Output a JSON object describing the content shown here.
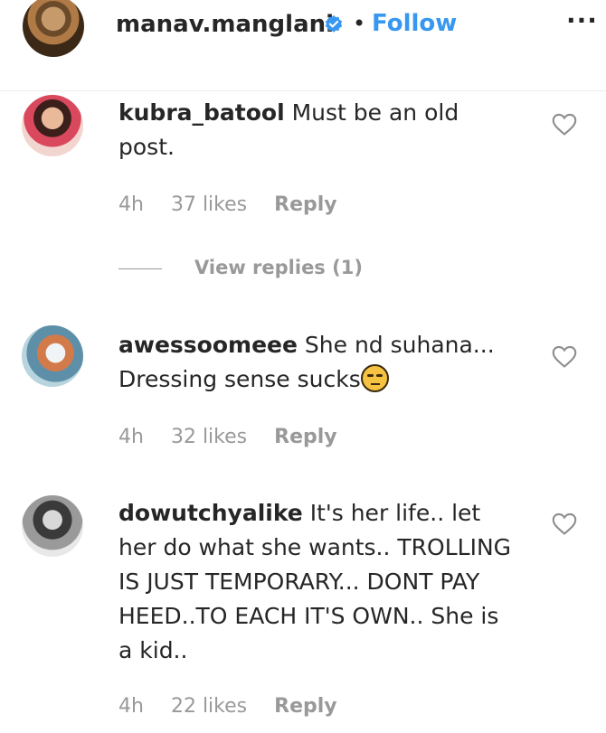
{
  "header": {
    "username": "manav.manglani",
    "separator": "•",
    "follow_label": "Follow",
    "more_label": "···"
  },
  "comments": [
    {
      "username": "kubra_batool",
      "text": " Must be an old post.",
      "time": "4h",
      "likes": "37 likes",
      "reply_label": "Reply",
      "view_replies": "View replies (1)"
    },
    {
      "username": "awessoomeee",
      "text": " She nd suhana... Dressing sense sucks",
      "time": "4h",
      "likes": "32 likes",
      "reply_label": "Reply"
    },
    {
      "username": "dowutchyalike",
      "text": " It's her life.. let her do what she wants.. TROLLING IS JUST TEMPORARY... DONT PAY HEED..TO EACH IT'S OWN.. She is a kid..",
      "time": "4h",
      "likes": "22 likes",
      "reply_label": "Reply"
    }
  ],
  "colors": {
    "link": "#3897f0",
    "muted": "#999999",
    "text": "#262626"
  },
  "icons": [
    "verified-badge-icon",
    "heart-icon",
    "unamused-face-emoji",
    "more-options-icon"
  ]
}
